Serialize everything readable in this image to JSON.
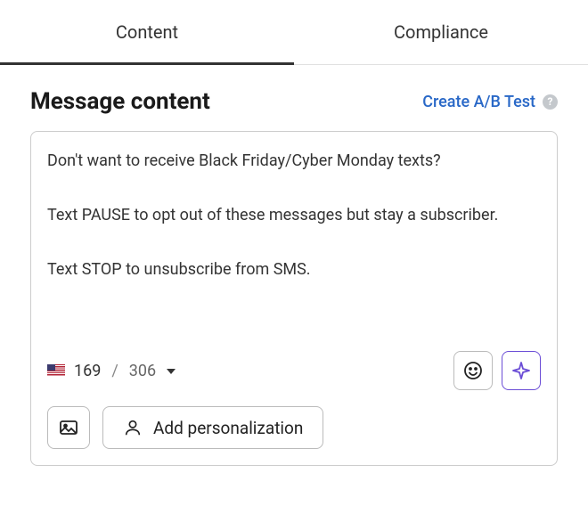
{
  "tabs": {
    "content": "Content",
    "compliance": "Compliance",
    "active": "content"
  },
  "section": {
    "title": "Message content",
    "ab_test": "Create A/B Test",
    "help_symbol": "?"
  },
  "message": {
    "text": "Don't want to receive Black Friday/Cyber Monday texts?\n\nText PAUSE to opt out of these messages but stay a subscriber.\n\nText STOP to unsubscribe from SMS."
  },
  "counter": {
    "current": "169",
    "separator": "/",
    "max": "306"
  },
  "buttons": {
    "add_personalization": "Add personalization"
  },
  "icons": {
    "emoji": "emoji-icon",
    "sparkle": "sparkle-icon",
    "image": "image-icon",
    "person": "person-icon",
    "flag": "us-flag-icon",
    "caret": "caret-down-icon",
    "help": "help-icon"
  }
}
